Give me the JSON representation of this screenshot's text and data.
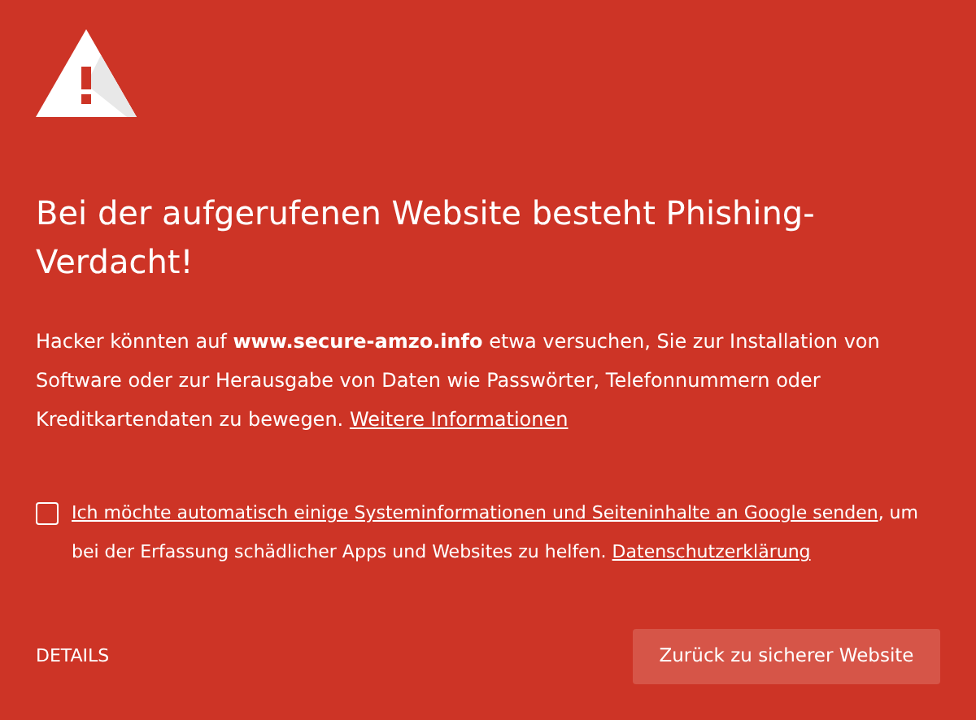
{
  "heading": "Bei der aufgerufenen Website besteht Phishing-Verdacht!",
  "description": "Hacker könnten auf **www.secure-amzo.info** etwa versuchen, Sie zur Installation von Software oder zur Herausgabe von Daten wie Passwörter, Telefonnummern oder Kreditkartendaten zu bewegen.",
  "more_link": "Weitere Informationen",
  "consent": {
    "checked": false,
    "link": "Ich möchte automatisch einige Systeminformationen und Seiteninhalte an Google senden",
    "text": ", um bei der Erfassung schädlicher Apps und Websites zu helfen.",
    "privacy_link": "Datenschutzerklärung"
  },
  "details_button": "DETAILS",
  "back_button": "Zurück zu sicherer Website"
}
